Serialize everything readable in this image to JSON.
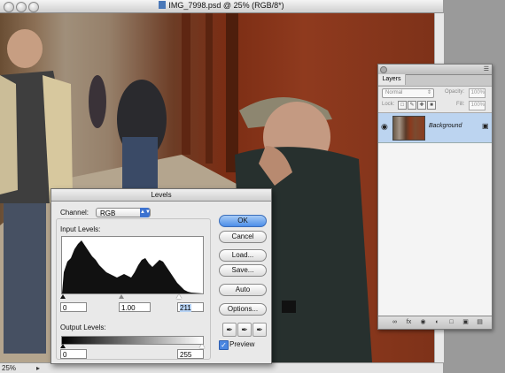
{
  "window": {
    "title": "IMG_7998.psd @ 25% (RGB/8*)"
  },
  "status": {
    "zoom": "25%"
  },
  "layers_panel": {
    "tab": "Layers",
    "blend_mode": "Normal",
    "opacity_label": "Opacity:",
    "opacity_value": "100%",
    "lock_label": "Lock:",
    "fill_label": "Fill:",
    "fill_value": "100%",
    "layers": [
      {
        "name": "Background",
        "locked": true,
        "visible": true
      }
    ],
    "footer_icons": [
      "link-icon",
      "fx-icon",
      "mask-icon",
      "adjustment-icon",
      "folder-icon",
      "new-layer-icon",
      "trash-icon"
    ]
  },
  "levels": {
    "title": "Levels",
    "channel_label": "Channel:",
    "channel_value": "RGB",
    "input_levels_label": "Input Levels:",
    "input_black": "0",
    "input_gamma": "1.00",
    "input_white": "211",
    "output_levels_label": "Output Levels:",
    "output_black": "0",
    "output_white": "255",
    "buttons": {
      "ok": "OK",
      "cancel": "Cancel",
      "load": "Load...",
      "save": "Save...",
      "auto": "Auto",
      "options": "Options..."
    },
    "preview_label": "Preview",
    "preview_checked": true
  }
}
